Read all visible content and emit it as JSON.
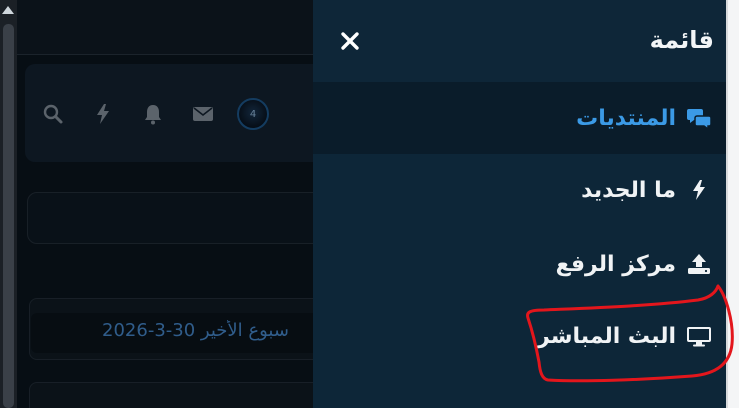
{
  "menu": {
    "title": "قائمة",
    "items": [
      {
        "label": "المنتديات",
        "icon": "forums-icon",
        "active": true
      },
      {
        "label": "ما الجديد",
        "icon": "whats-new-icon",
        "active": false
      },
      {
        "label": "مركز الرفع",
        "icon": "upload-icon",
        "active": false
      },
      {
        "label": "البث المباشر",
        "icon": "live-stream-icon",
        "active": false
      }
    ]
  },
  "background": {
    "date_text": "سبوع الأخير 30-3-2026",
    "nav_icons": [
      "search-icon",
      "bolt-icon",
      "bell-icon",
      "envelope-icon",
      "avatar"
    ],
    "avatar_badge": "4"
  },
  "colors": {
    "accent": "#3b9ae6",
    "menu_bg": "#0d2638",
    "active_bg": "#0a1c2a",
    "annotation": "#e3161c"
  }
}
